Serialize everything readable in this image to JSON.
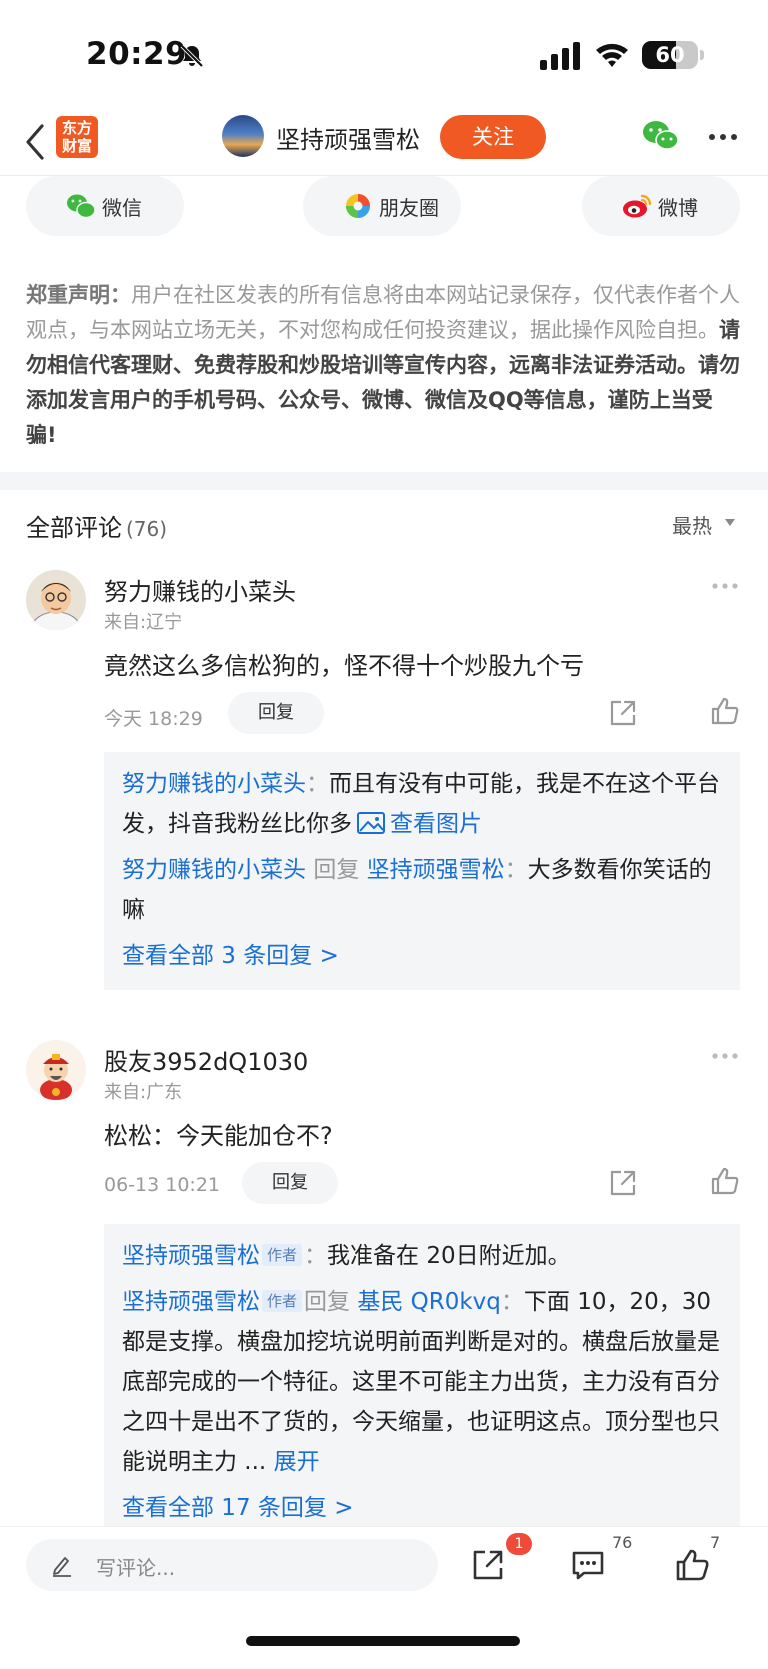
{
  "status_bar": {
    "time": "20:29",
    "battery": "60",
    "battery_level_percent": 60
  },
  "nav": {
    "logo_text": "东方\n财富",
    "author_name": "坚持顽强雪松",
    "follow_label": "关注"
  },
  "share": {
    "wechat": "微信",
    "moments": "朋友圈",
    "weibo": "微博"
  },
  "disclaimer": {
    "label": "郑重声明：",
    "text": "用户在社区发表的所有信息将由本网站记录保存，仅代表作者个人观点，与本网站立场无关，不对您构成任何投资建议，据此操作风险自担。",
    "warning": "请勿相信代客理财、免费荐股和炒股培训等宣传内容，远离非法证券活动。请勿添加发言用户的手机号码、公众号、微博、微信及QQ等信息，谨防上当受骗!"
  },
  "comments_header": {
    "title": "全部评论",
    "count": "(76)",
    "sort": "最热"
  },
  "comments": [
    {
      "name": "努力赚钱的小菜头",
      "location": "来自:辽宁",
      "text": "竟然这么多信松狗的，怪不得十个炒股九个亏",
      "time": "今天 18:29",
      "reply_label": "回复",
      "replies": [
        {
          "from": "努力赚钱的小菜头",
          "sep": "：",
          "text": "而且有没有中可能，我是不在这个平台发，抖音我粉丝比你多",
          "image_link": "查看图片"
        },
        {
          "from": "努力赚钱的小菜头",
          "reply_word": "回复",
          "to": "坚持顽强雪松",
          "sep": "：",
          "text": "大多数看你笑话的嘛"
        }
      ],
      "view_all": "查看全部 3 条回复 >"
    },
    {
      "name": "股友3952dQ1030",
      "location": "来自:广东",
      "text": "松松：今天能加仓不?",
      "time": "06-13 10:21",
      "reply_label": "回复",
      "replies": [
        {
          "from": "坚持顽强雪松",
          "tag": "作者",
          "sep": "：",
          "text": "我准备在 20日附近加。"
        },
        {
          "from": "坚持顽强雪松",
          "tag": "作者",
          "reply_word": "回复",
          "to": "基民 QR0kvq",
          "sep": "：",
          "text": "下面 10，20，30 都是支撑。横盘加挖坑说明前面判断是对的。横盘后放量是底部完成的一个特征。这里不可能主力出货，主力没有百分之四十是出不了货的，今天缩量，也证明这点。顶分型也只能说明主力 ...",
          "expand": "展开"
        }
      ],
      "view_all": "查看全部 17 条回复 >"
    }
  ],
  "bottom_bar": {
    "placeholder": "写评论...",
    "share_badge": "1",
    "comment_count": "76",
    "like_count": "7"
  },
  "colors": {
    "brand_orange": "#f05a22",
    "link_blue": "#1a6fd4",
    "badge_red": "#f04a3a"
  },
  "icons": [
    "bell-slash-icon",
    "signal-icon",
    "wifi-icon",
    "battery-icon",
    "back-icon",
    "wechat-icon",
    "more-icon",
    "moments-icon",
    "weibo-icon",
    "caret-down-icon",
    "share-icon",
    "like-icon",
    "image-icon",
    "pen-icon",
    "comment-icon"
  ]
}
